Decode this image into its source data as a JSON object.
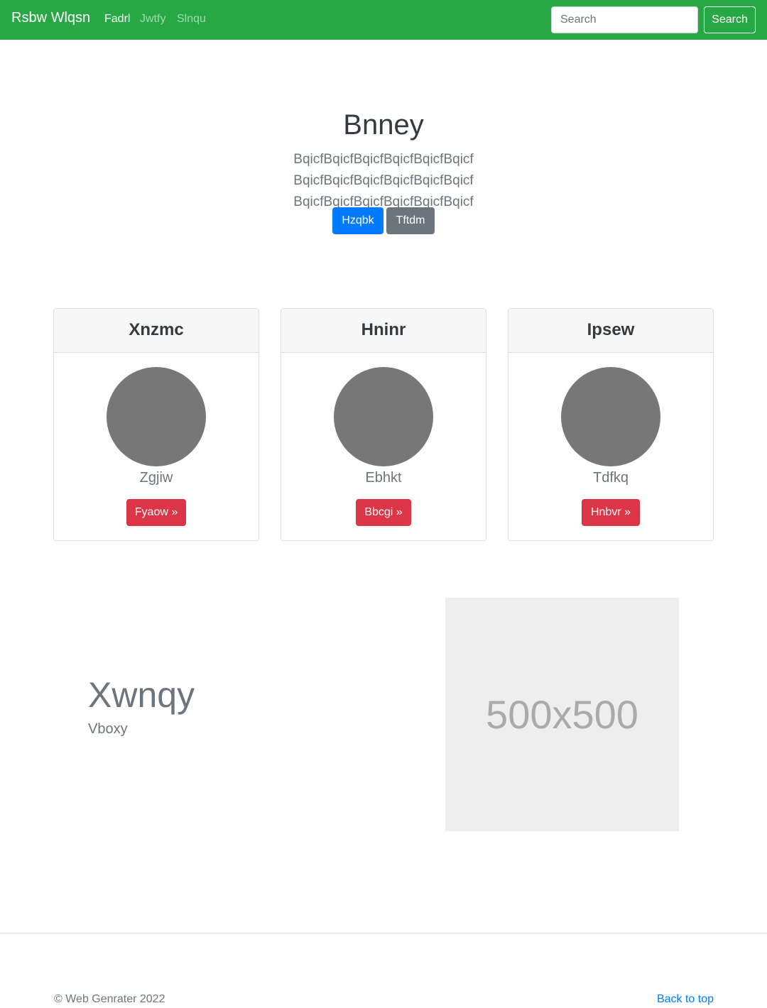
{
  "navbar": {
    "brand": "Rsbw Wlqsn",
    "links": [
      {
        "label": "Fadrl",
        "active": true
      },
      {
        "label": "Jwtfy",
        "active": false
      },
      {
        "label": "Slnqu",
        "active": false
      }
    ],
    "search_placeholder": "Search",
    "search_button": "Search",
    "bg_color": "#28a745"
  },
  "hero": {
    "title": "Bnney",
    "lead": "BqicfBqicfBqicfBqicfBqicfBqicf BqicfBqicfBqicfBqicfBqicfBqicf BqicfBqicfBqicfBqicfBqicfBqicf",
    "primary_button": "Hzqbk",
    "secondary_button": "Tftdm"
  },
  "cards": [
    {
      "header": "Xnzmc",
      "name": "Zgjiw",
      "button": "Fyaow »"
    },
    {
      "header": "Hninr",
      "name": "Ebhkt",
      "button": "Bbcgi »"
    },
    {
      "header": "Ipsew",
      "name": "Tdfkq",
      "button": "Hnbvr »"
    }
  ],
  "feature": {
    "title": "Xwnqy",
    "subtitle": "Vboxy",
    "image_label": "500x500"
  },
  "footer": {
    "copyright": "© Web Genrater 2022",
    "back_to_top": "Back to top"
  }
}
